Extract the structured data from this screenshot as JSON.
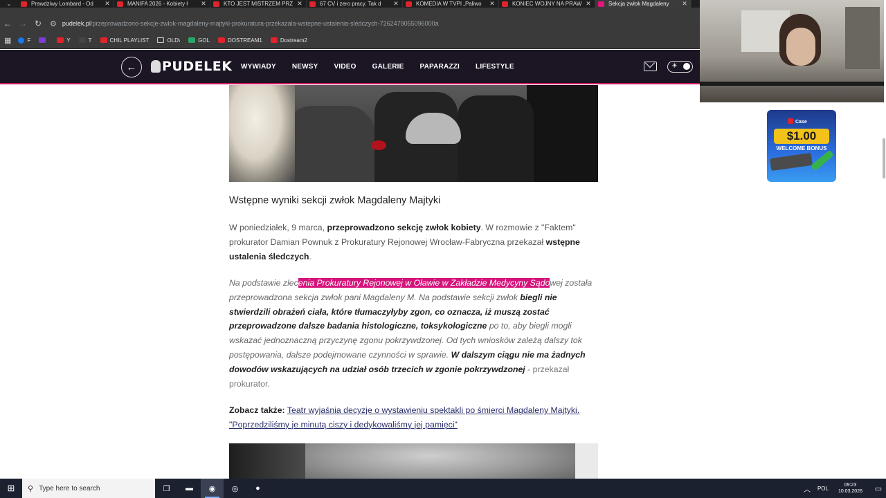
{
  "browser": {
    "tabs": [
      {
        "title": "Prawdziwy Lombard - Od",
        "icon": "youtube-icon"
      },
      {
        "title": "MANIFA 2026 - Kobiety ł",
        "icon": "youtube-icon"
      },
      {
        "title": "KTO JEST MISTRZEM PRZ",
        "icon": "youtube-icon"
      },
      {
        "title": "67 CV i zero pracy. Tak d",
        "icon": "youtube-icon"
      },
      {
        "title": "KOMEDIA W TVPI „Paliwo",
        "icon": "youtube-icon"
      },
      {
        "title": "KONIEC WOJNY NA PRAW",
        "icon": "youtube-icon"
      },
      {
        "title": "Sekcja zwłok Magdaleny",
        "icon": "pudelek-icon",
        "active": true
      }
    ],
    "url_domain": "pudelek.pl",
    "url_path": "/przeprowadzono-sekcje-zwlok-magdaleny-majtyki-prokuratura-przekazala-wstepne-ustalenia-sledczych-7262479055096000a",
    "bookmarks": [
      {
        "label": "F",
        "icon": "facebook-icon"
      },
      {
        "label": "",
        "icon": "twitch-icon"
      },
      {
        "label": "Y",
        "icon": "youtube-icon"
      },
      {
        "label": "T",
        "icon": "x-icon"
      },
      {
        "label": "CHIL PLAYLIST",
        "icon": "youtube-icon"
      },
      {
        "label": "OLD\\",
        "icon": "folder-icon"
      },
      {
        "label": "GOL",
        "icon": "gol-icon"
      },
      {
        "label": "DOSTREAM1",
        "icon": "youtube-icon"
      },
      {
        "label": "Dostream2",
        "icon": "youtube-icon"
      }
    ]
  },
  "site": {
    "logo": "PUDELEK",
    "nav": [
      "WYWIADY",
      "NEWSY",
      "VIDEO",
      "GALERIE",
      "PAPARAZZI",
      "LIFESTYLE"
    ]
  },
  "article": {
    "heading": "Wstępne wyniki sekcji zwłok Magdaleny Majtyki",
    "p1": {
      "a": "W poniedziałek, 9 marca, ",
      "b": "przeprowadzono sekcję zwłok kobiety",
      "c": ". W rozmowie z \"Faktem\" prokurator Damian Pownuk z Prokuratury Rejonowej Wrocław-Fabryczna przekazał ",
      "d": "wstępne ustalenia śledczych",
      "e": "."
    },
    "p2": {
      "a": "Na podstawie zlec",
      "highlight": "enia Prokuratury Rejonowej w Oławie w Zakładzie Medycyny Sądo",
      "b": "wej została przeprowadzona sekcja zwłok pani Magdaleny M. Na podstawie sekcji zwłok ",
      "c": "biegli nie stwierdzili obrażeń ciała, które tłumaczyłyby zgon, co oznacza, iż muszą zostać przeprowadzone dalsze badania histologiczne, toksykologiczne",
      "d": " po to, aby biegli mogli wskazać jednoznaczną przyczynę zgonu pokrzywdzonej. Od tych wniosków zależą dalszy tok postępowania, dalsze podejmowane czynności w sprawie. ",
      "e": "W dalszym ciągu nie ma żadnych dowodów wskazujących na udział osób trzecich w zgonie pokrzywdzonej",
      "f": " - przekazał prokurator."
    },
    "see_also_label": "Zobacz także:",
    "see_also_link": "Teatr wyjaśnia decyzję o wystawieniu spektakli po śmierci Magdaleny Majtyki. \"Poprzedziliśmy je minutą ciszy i dedykowaliśmy jej pamięci\""
  },
  "ad": {
    "brand": "Case",
    "amount": "$1.00",
    "bonus": "WELCOME BONUS"
  },
  "taskbar": {
    "search_placeholder": "Type here to search",
    "lang": "POL",
    "time": "09:23",
    "date": "10.03.2026"
  },
  "colors": {
    "accent": "#d4147a",
    "header_bg": "#1b1524",
    "link": "#2a2f6b"
  }
}
